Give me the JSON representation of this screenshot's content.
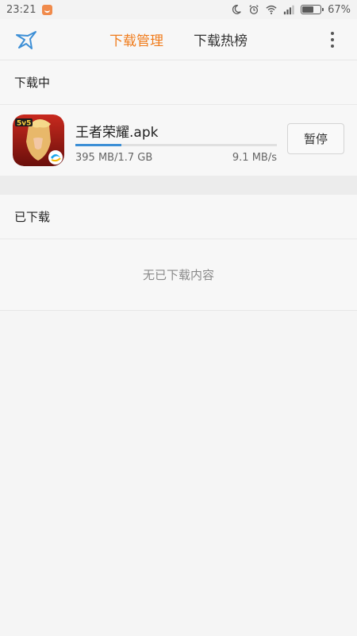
{
  "status_bar": {
    "time": "23:21",
    "battery_percent": "67%",
    "battery_level": 0.67,
    "icons": [
      "notification-badge-icon",
      "moon-icon",
      "alarm-icon",
      "wifi-icon",
      "signal-icon",
      "battery-icon"
    ]
  },
  "app_bar": {
    "logo_icon": "bird-logo-icon",
    "tabs": [
      {
        "label": "下载管理",
        "active": true
      },
      {
        "label": "下载热榜",
        "active": false
      }
    ],
    "menu_icon": "more-vertical-icon",
    "accent_color": "#f07c1c"
  },
  "downloading": {
    "header": "下载中",
    "items": [
      {
        "file_name": "王者荣耀.apk",
        "progress_text": "395 MB/1.7 GB",
        "progress_fraction": 0.227,
        "speed": "9.1 MB/s",
        "action_label": "暂停",
        "icon": "game-app-icon",
        "progress_color": "#3d8fd6"
      }
    ]
  },
  "downloaded": {
    "header": "已下载",
    "empty_text": "无已下载内容"
  }
}
